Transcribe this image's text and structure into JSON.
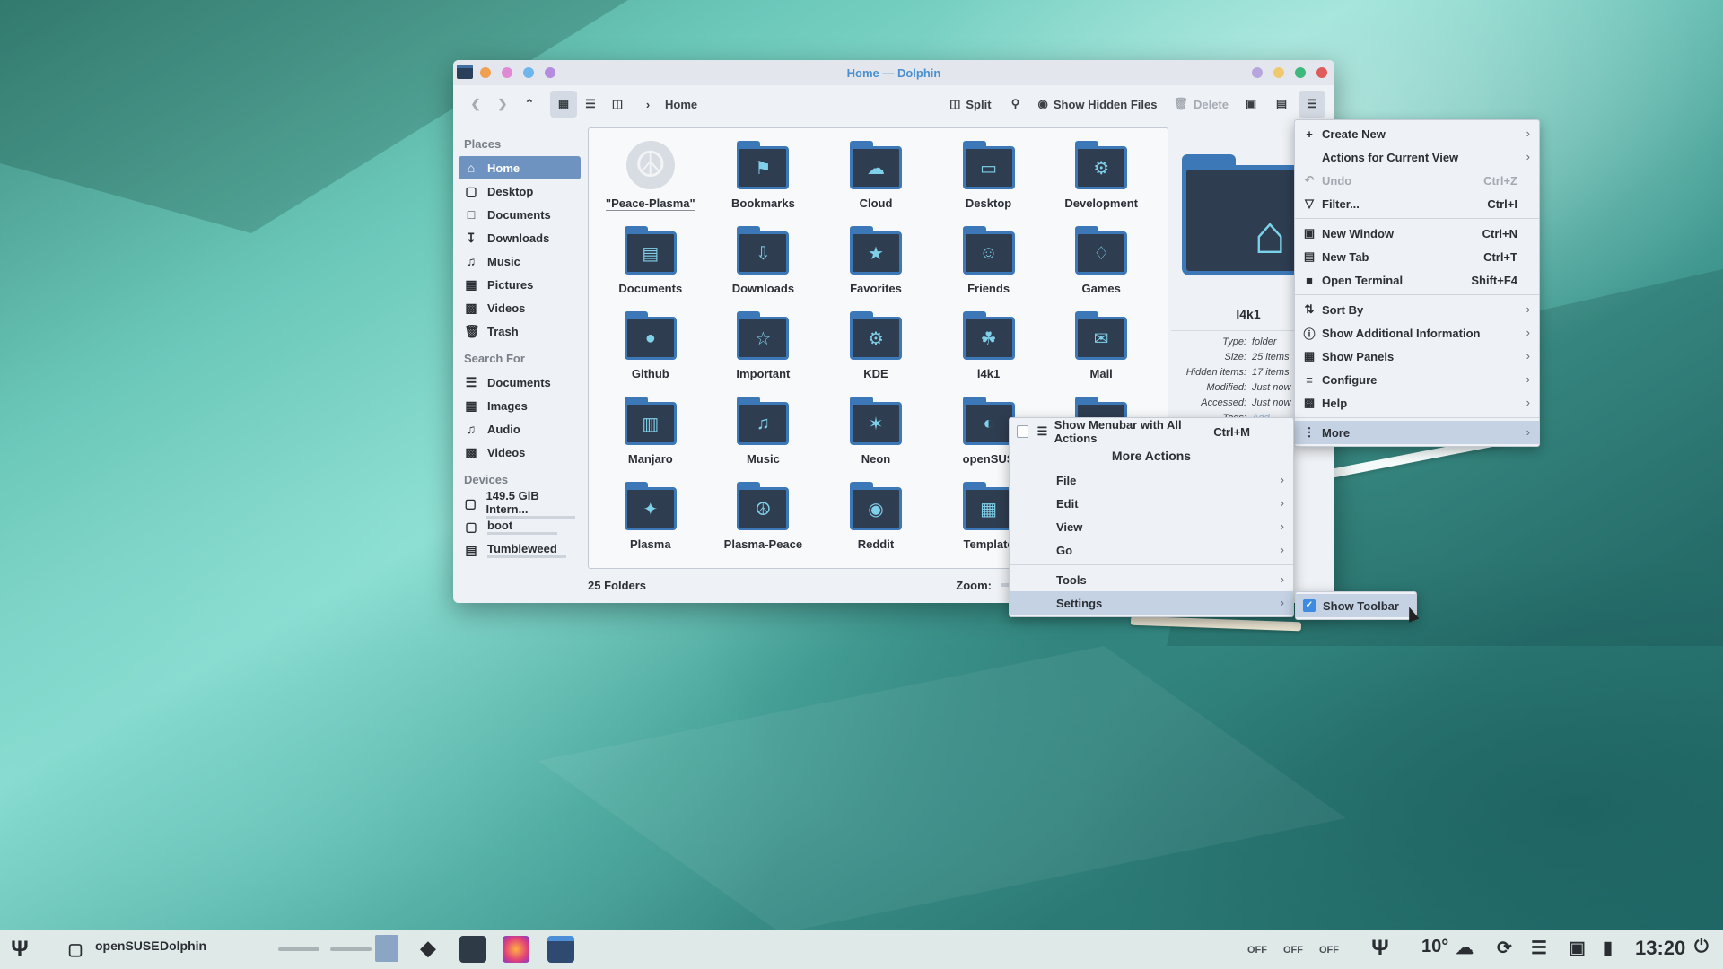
{
  "window": {
    "title": "Home — Dolphin",
    "colors": {
      "accent": "#3d8ae0",
      "selection": "#6e93c0"
    }
  },
  "toolbar": {
    "breadcrumb": "Home",
    "split": "Split",
    "show_hidden": "Show Hidden Files",
    "delete": "Delete"
  },
  "sidebar": {
    "places_head": "Places",
    "places": [
      "Home",
      "Desktop",
      "Documents",
      "Downloads",
      "Music",
      "Pictures",
      "Videos",
      "Trash"
    ],
    "search_head": "Search For",
    "search": [
      "Documents",
      "Images",
      "Audio",
      "Videos"
    ],
    "devices_head": "Devices",
    "devices": [
      "149.5 GiB Intern...",
      "boot",
      "Tumbleweed"
    ]
  },
  "files": [
    {
      "name": "\"Peace-Plasma\"",
      "icon": "peace-icon"
    },
    {
      "name": "Bookmarks",
      "icon": "bookmark-icon"
    },
    {
      "name": "Cloud",
      "icon": "cloud-icon"
    },
    {
      "name": "Desktop",
      "icon": "desktop-icon"
    },
    {
      "name": "Development",
      "icon": "gear-icon"
    },
    {
      "name": "Documents",
      "icon": "document-icon"
    },
    {
      "name": "Downloads",
      "icon": "download-icon"
    },
    {
      "name": "Favorites",
      "icon": "star-icon"
    },
    {
      "name": "Friends",
      "icon": "people-icon"
    },
    {
      "name": "Games",
      "icon": "gamepad-icon"
    },
    {
      "name": "Github",
      "icon": "github-icon"
    },
    {
      "name": "Important",
      "icon": "trophy-icon"
    },
    {
      "name": "KDE",
      "icon": "kde-icon"
    },
    {
      "name": "l4k1",
      "icon": "lizard-icon"
    },
    {
      "name": "Mail",
      "icon": "mail-icon"
    },
    {
      "name": "Manjaro",
      "icon": "manjaro-icon"
    },
    {
      "name": "Music",
      "icon": "music-icon"
    },
    {
      "name": "Neon",
      "icon": "neon-icon"
    },
    {
      "name": "openSUS",
      "icon": "opensuse-icon"
    },
    {
      "name": "",
      "icon": "folder-icon"
    },
    {
      "name": "Plasma",
      "icon": "plasma-icon"
    },
    {
      "name": "Plasma-Peace",
      "icon": "plasma-peace-icon"
    },
    {
      "name": "Reddit",
      "icon": "reddit-icon"
    },
    {
      "name": "Template",
      "icon": "template-icon"
    },
    {
      "name": "",
      "icon": "folder-icon"
    }
  ],
  "status": {
    "count": "25 Folders",
    "zoom_label": "Zoom:",
    "zoom_level": 0.2
  },
  "info": {
    "name": "l4k1",
    "rows": [
      {
        "k": "Type:",
        "v": "folder"
      },
      {
        "k": "Size:",
        "v": "25 items"
      },
      {
        "k": "Hidden items:",
        "v": "17 items"
      },
      {
        "k": "Modified:",
        "v": "Just now"
      },
      {
        "k": "Accessed:",
        "v": "Just now"
      },
      {
        "k": "Tags:",
        "v": "Add..."
      }
    ]
  },
  "main_menu": {
    "items": [
      {
        "label": "Create New",
        "icon": "plus-icon",
        "sc": "",
        "sub": true
      },
      {
        "label": "Actions for Current View",
        "icon": "",
        "sc": "",
        "sub": true
      },
      {
        "label": "Undo",
        "icon": "undo-icon",
        "sc": "Ctrl+Z",
        "disabled": true
      },
      {
        "label": "Filter...",
        "icon": "filter-icon",
        "sc": "Ctrl+I"
      },
      {
        "sep": true
      },
      {
        "label": "New Window",
        "icon": "window-icon",
        "sc": "Ctrl+N"
      },
      {
        "label": "New Tab",
        "icon": "tab-icon",
        "sc": "Ctrl+T"
      },
      {
        "label": "Open Terminal",
        "icon": "terminal-icon",
        "sc": "Shift+F4"
      },
      {
        "sep": true
      },
      {
        "label": "Sort By",
        "icon": "sort-icon",
        "sc": "",
        "sub": true
      },
      {
        "label": "Show Additional Information",
        "icon": "info-icon",
        "sc": "",
        "sub": true
      },
      {
        "label": "Show Panels",
        "icon": "panels-icon",
        "sc": "",
        "sub": true
      },
      {
        "label": "Configure",
        "icon": "configure-icon",
        "sc": "",
        "sub": true
      },
      {
        "label": "Help",
        "icon": "help-icon",
        "sc": "",
        "sub": true
      },
      {
        "sep": true
      },
      {
        "label": "More",
        "icon": "more-icon",
        "sc": "",
        "sub": true,
        "hl": true
      }
    ]
  },
  "more_menu": {
    "menubar_label": "Show Menubar with All Actions",
    "menubar_sc": "Ctrl+M",
    "head": "More Actions",
    "items": [
      {
        "label": "File"
      },
      {
        "label": "Edit"
      },
      {
        "label": "View"
      },
      {
        "label": "Go"
      },
      {
        "sep": true
      },
      {
        "label": "Tools"
      },
      {
        "label": "Settings",
        "hl": true
      }
    ]
  },
  "settings_menu": {
    "show_toolbar": "Show Toolbar",
    "checked": true
  },
  "taskbar": {
    "label1": "openSUSE",
    "label2": "Dolphin",
    "off1": "OFF",
    "off2": "OFF",
    "off3": "OFF",
    "temp": "10°",
    "clock": "13:20"
  }
}
